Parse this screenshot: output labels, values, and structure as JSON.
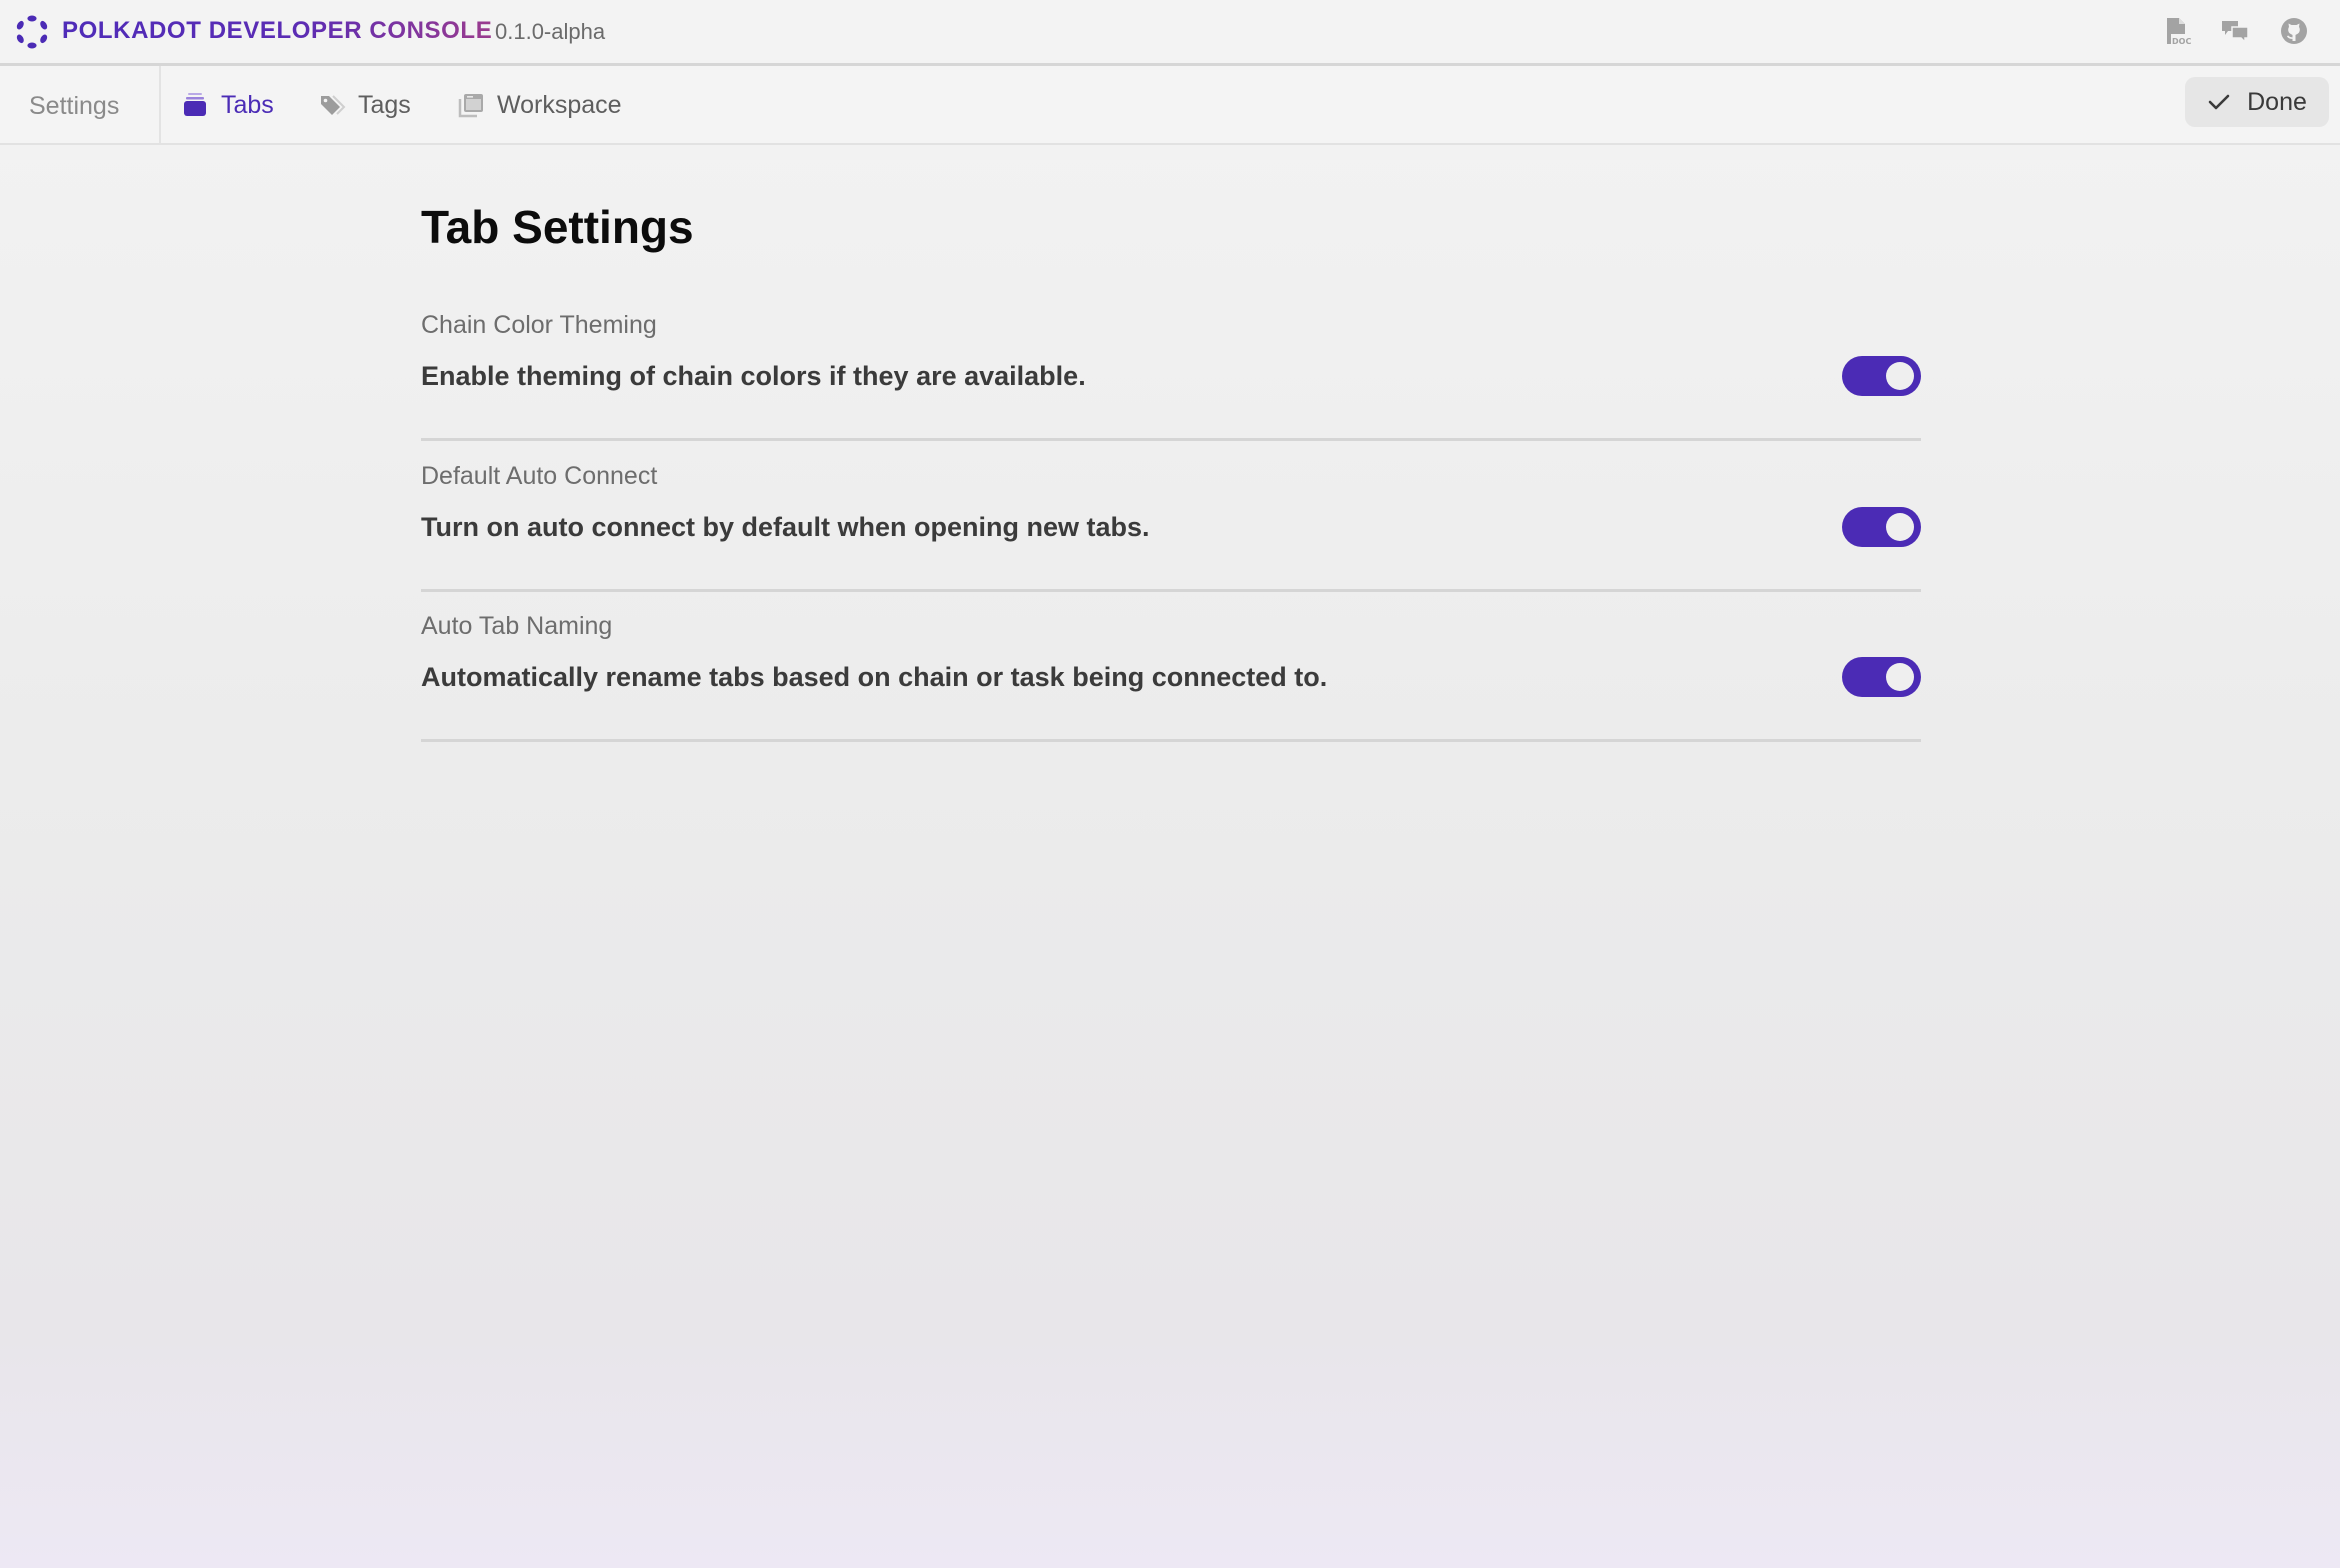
{
  "titlebar": {
    "app_title": "POLKADOT DEVELOPER CONSOLE",
    "version": "0.1.0-alpha",
    "logo_icon": "polkadot-logo-icon",
    "icons": [
      {
        "name": "docs-icon",
        "label": "DOC"
      },
      {
        "name": "chat-icon"
      },
      {
        "name": "github-icon"
      }
    ]
  },
  "tabbar": {
    "section_label": "Settings",
    "tabs": [
      {
        "label": "Tabs",
        "icon": "tabs-stack-icon",
        "active": true
      },
      {
        "label": "Tags",
        "icon": "tag-icon",
        "active": false
      },
      {
        "label": "Workspace",
        "icon": "workspace-window-icon",
        "active": false
      }
    ],
    "done_label": "Done",
    "done_icon": "checkmark-icon"
  },
  "main": {
    "title": "Tab Settings",
    "settings": [
      {
        "label": "Chain Color Theming",
        "description": "Enable theming of chain colors if they are available.",
        "enabled": true
      },
      {
        "label": "Default Auto Connect",
        "description": "Turn on auto connect by default when opening new tabs.",
        "enabled": true
      },
      {
        "label": "Auto Tab Naming",
        "description": "Automatically rename tabs based on chain or task being connected to.",
        "enabled": true
      }
    ]
  },
  "colors": {
    "accent": "#4b2bb5",
    "title_gradient_end": "#9a3b8e",
    "icon_gray": "#a0a0a0"
  }
}
